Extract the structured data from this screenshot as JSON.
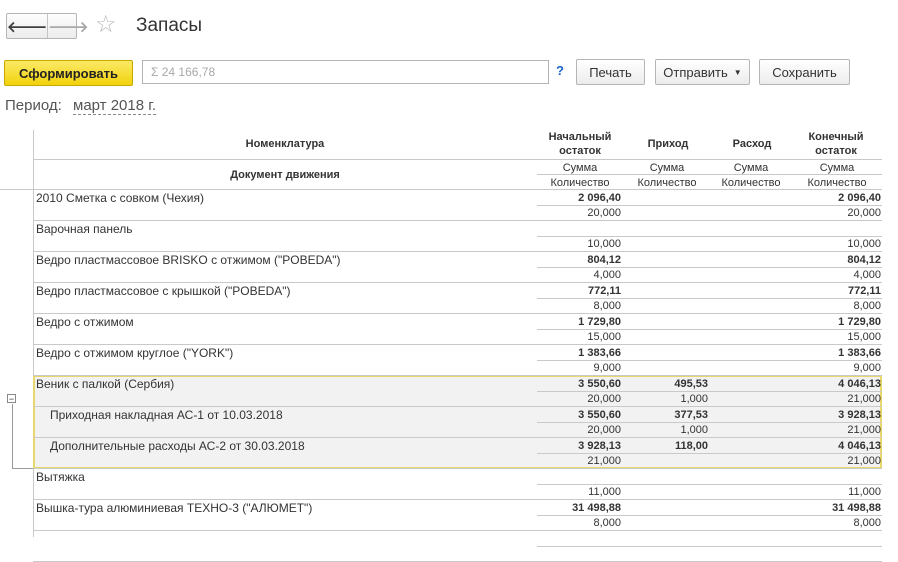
{
  "window": {
    "title": "Запасы"
  },
  "nav": {
    "back_glyph": "🡐",
    "forward_glyph": "🡒",
    "star_glyph": "☆"
  },
  "toolbar": {
    "generate_label": "Сформировать",
    "sum_placeholder": "Σ 24 166,78",
    "help_label": "?",
    "print_label": "Печать",
    "send_label": "Отправить",
    "save_label": "Сохранить"
  },
  "period": {
    "label": "Период:",
    "value": "март 2018 г."
  },
  "report": {
    "headers": {
      "nomenclature": "Номенклатура",
      "document": "Документ движения",
      "start": "Начальный остаток",
      "income": "Приход",
      "expense": "Расход",
      "end": "Конечный остаток",
      "sum": "Сумма",
      "qty": "Количество"
    },
    "rows": [
      {
        "name": "2010 Сметка с совком (Чехия)",
        "start_sum": "2 096,40",
        "start_qty": "20,000",
        "in_sum": "",
        "in_qty": "",
        "out_sum": "",
        "out_qty": "",
        "end_sum": "2 096,40",
        "end_qty": "20,000"
      },
      {
        "name": "Варочная панель",
        "start_sum": "",
        "start_qty": "10,000",
        "in_sum": "",
        "in_qty": "",
        "out_sum": "",
        "out_qty": "",
        "end_sum": "",
        "end_qty": "10,000"
      },
      {
        "name": "Ведро пластмассовое BRISKO с отжимом (\"POBEDA\")",
        "start_sum": "804,12",
        "start_qty": "4,000",
        "in_sum": "",
        "in_qty": "",
        "out_sum": "",
        "out_qty": "",
        "end_sum": "804,12",
        "end_qty": "4,000"
      },
      {
        "name": "Ведро пластмассовое с крышкой (\"POBEDA\")",
        "start_sum": "772,11",
        "start_qty": "8,000",
        "in_sum": "",
        "in_qty": "",
        "out_sum": "",
        "out_qty": "",
        "end_sum": "772,11",
        "end_qty": "8,000"
      },
      {
        "name": "Ведро с отжимом",
        "start_sum": "1 729,80",
        "start_qty": "15,000",
        "in_sum": "",
        "in_qty": "",
        "out_sum": "",
        "out_qty": "",
        "end_sum": "1 729,80",
        "end_qty": "15,000"
      },
      {
        "name": "Ведро с отжимом  круглое (\"YORK\")",
        "start_sum": "1 383,66",
        "start_qty": "9,000",
        "in_sum": "",
        "in_qty": "",
        "out_sum": "",
        "out_qty": "",
        "end_sum": "1 383,66",
        "end_qty": "9,000"
      },
      {
        "name": "Веник с палкой (Сербия)",
        "start_sum": "3 550,60",
        "start_qty": "20,000",
        "in_sum": "495,53",
        "in_qty": "1,000",
        "out_sum": "",
        "out_qty": "",
        "end_sum": "4 046,13",
        "end_qty": "21,000"
      },
      {
        "name": "Приходная накладная АС-1 от 10.03.2018",
        "start_sum": "3 550,60",
        "start_qty": "20,000",
        "in_sum": "377,53",
        "in_qty": "1,000",
        "out_sum": "",
        "out_qty": "",
        "end_sum": "3 928,13",
        "end_qty": "21,000"
      },
      {
        "name": "Дополнительные расходы АС-2 от 30.03.2018",
        "start_sum": "3 928,13",
        "start_qty": "21,000",
        "in_sum": "118,00",
        "in_qty": "",
        "out_sum": "",
        "out_qty": "",
        "end_sum": "4 046,13",
        "end_qty": "21,000"
      },
      {
        "name": "Вытяжка",
        "start_sum": "",
        "start_qty": "11,000",
        "in_sum": "",
        "in_qty": "",
        "out_sum": "",
        "out_qty": "",
        "end_sum": "",
        "end_qty": "11,000"
      },
      {
        "name": "Вышка-тура алюминиевая ТЕХНО-3 (\"АЛЮМЕТ\")",
        "start_sum": "31 498,88",
        "start_qty": "8,000",
        "in_sum": "",
        "in_qty": "",
        "out_sum": "",
        "out_qty": "",
        "end_sum": "31 498,88",
        "end_qty": "8,000"
      },
      {
        "name": "",
        "start_sum": "",
        "start_qty": "",
        "in_sum": "",
        "in_qty": "",
        "out_sum": "",
        "out_qty": "",
        "end_sum": "",
        "end_qty": ""
      }
    ]
  },
  "colors": {
    "accent_button": "#f2d20c",
    "group_highlight": "#e8d76a",
    "link": "#1a66c7"
  }
}
